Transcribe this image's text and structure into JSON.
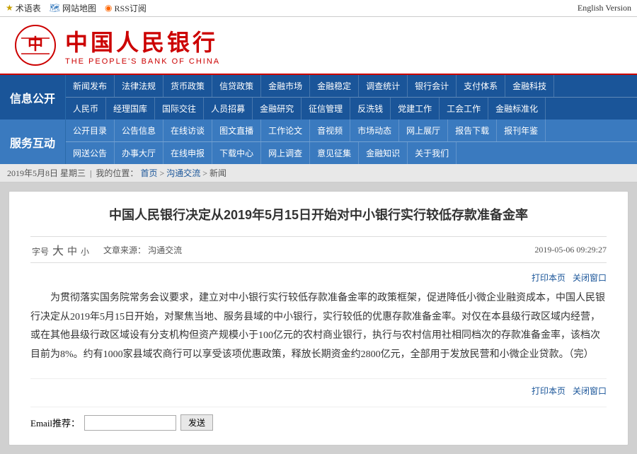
{
  "topbar": {
    "items": [
      {
        "label": "术语表",
        "icon": "star"
      },
      {
        "label": "网站地图",
        "icon": "map"
      },
      {
        "label": "RSS订阅",
        "icon": "rss"
      }
    ],
    "english": "English Version"
  },
  "header": {
    "logo_chinese": "中国人民银行",
    "logo_english": "THE PEOPLE'S BANK OF CHINA"
  },
  "nav": {
    "rows": [
      {
        "side_label": "信息公开",
        "items": [
          "新闻发布",
          "法律法规",
          "货币政策",
          "信贷政策",
          "金融市场",
          "金融稳定",
          "调查统计",
          "银行会计",
          "支付体系",
          "金融科技"
        ]
      },
      {
        "side_label": "",
        "items": [
          "人民币",
          "经理国库",
          "国际交往",
          "人员招募",
          "金融研究",
          "征信管理",
          "反洗钱",
          "党建工作",
          "工会工作",
          "金融标准化"
        ]
      },
      {
        "side_label": "服务互动",
        "items": [
          "公开目录",
          "公告信息",
          "在线访谈",
          "图文直播",
          "工作论文",
          "音视频",
          "市场动态",
          "网上展厅",
          "报告下载",
          "报刊年鉴"
        ]
      },
      {
        "side_label": "",
        "items": [
          "网送公告",
          "办事大厅",
          "在线申报",
          "下载中心",
          "网上调查",
          "意见征集",
          "金融知识",
          "关于我们"
        ]
      }
    ]
  },
  "breadcrumb": {
    "date": "2019年5月8日 星期三",
    "location_label": "我的位置：",
    "home": "首页",
    "separator1": ">",
    "section": "沟通交流",
    "separator2": ">",
    "current": "新闻"
  },
  "article": {
    "title": "中国人民银行决定从2019年5月15日开始对中小银行实行较低存款准备金率",
    "font_label": "字号",
    "font_large": "大",
    "font_mid": "中",
    "font_small": "小",
    "source_label": "文章来源：",
    "source": "沟通交流",
    "date": "2019-05-06 09:29:27",
    "print_label": "打印本页",
    "close_label": "关闭窗口",
    "body": "为贯彻落实国务院常务会议要求，建立对中小银行实行较低存款准备金率的政策框架，促进降低小微企业融资成本，中国人民银行决定从2019年5月15日开始，对聚焦当地、服务县域的中小银行，实行较低的优惠存款准备金率。对仅在本县级行政区域内经营，或在其他县级行政区域设有分支机构但资产规模小于100亿元的农村商业银行，执行与农村信用社相同档次的存款准备金率，该档次目前为8%。约有1000家县域农商行可以享受该项优惠政策，释放长期资金约2800亿元，全部用于发放民营和小微企业贷款。（完）",
    "email_label": "Email推荐：",
    "email_placeholder": "",
    "send_label": "发送"
  }
}
